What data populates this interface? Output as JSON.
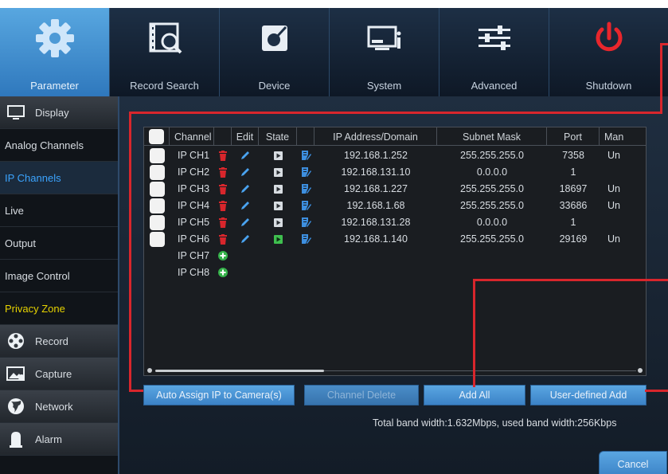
{
  "toolbar": {
    "items": [
      {
        "label": "Parameter",
        "icon": "gear-icon",
        "active": true
      },
      {
        "label": "Record Search",
        "icon": "film-search-icon"
      },
      {
        "label": "Device",
        "icon": "device-icon"
      },
      {
        "label": "System",
        "icon": "system-icon"
      },
      {
        "label": "Advanced",
        "icon": "sliders-icon"
      },
      {
        "label": "Shutdown",
        "icon": "power-icon"
      }
    ]
  },
  "sidebar": {
    "items": [
      {
        "label": "Display",
        "type": "category",
        "icon": "monitor-icon"
      },
      {
        "label": "Analog Channels",
        "type": "sub"
      },
      {
        "label": "IP Channels",
        "type": "sub",
        "selected": true
      },
      {
        "label": "Live",
        "type": "sub"
      },
      {
        "label": "Output",
        "type": "sub"
      },
      {
        "label": "Image Control",
        "type": "sub"
      },
      {
        "label": "Privacy Zone",
        "type": "sub",
        "highlight": true
      },
      {
        "label": "Record",
        "type": "category",
        "icon": "film-reel-icon"
      },
      {
        "label": "Capture",
        "type": "category",
        "icon": "capture-icon"
      },
      {
        "label": "Network",
        "type": "category",
        "icon": "globe-icon"
      },
      {
        "label": "Alarm",
        "type": "category",
        "icon": "alarm-icon"
      }
    ]
  },
  "table": {
    "headers": {
      "channel": "Channel",
      "edit": "Edit",
      "state": "State",
      "ip": "IP Address/Domain",
      "mask": "Subnet Mask",
      "port": "Port",
      "manufacturer": "Man"
    },
    "rows": [
      {
        "channel": "IP CH1",
        "ip": "192.168.1.252",
        "mask": "255.255.255.0",
        "port": "7358",
        "man": "Un",
        "configured": true,
        "state": "idle"
      },
      {
        "channel": "IP CH2",
        "ip": "192.168.131.10",
        "mask": "0.0.0.0",
        "port": "1",
        "man": "",
        "configured": true,
        "state": "idle"
      },
      {
        "channel": "IP CH3",
        "ip": "192.168.1.227",
        "mask": "255.255.255.0",
        "port": "18697",
        "man": "Un",
        "configured": true,
        "state": "idle"
      },
      {
        "channel": "IP CH4",
        "ip": "192.168.1.68",
        "mask": "255.255.255.0",
        "port": "33686",
        "man": "Un",
        "configured": true,
        "state": "idle"
      },
      {
        "channel": "IP CH5",
        "ip": "192.168.131.28",
        "mask": "0.0.0.0",
        "port": "1",
        "man": "",
        "configured": true,
        "state": "idle"
      },
      {
        "channel": "IP CH6",
        "ip": "192.168.1.140",
        "mask": "255.255.255.0",
        "port": "29169",
        "man": "Un",
        "configured": true,
        "state": "connected"
      },
      {
        "channel": "IP CH7",
        "configured": false
      },
      {
        "channel": "IP CH8",
        "configured": false
      }
    ]
  },
  "buttons": {
    "auto_assign": "Auto Assign IP to Camera(s)",
    "channel_delete": "Channel Delete",
    "add_all": "Add All",
    "user_defined_add": "User-defined Add",
    "cancel": "Cancel"
  },
  "status": {
    "bandwidth": "Total band width:1.632Mbps, used band width:256Kbps"
  },
  "colors": {
    "accent": "#3ba4ff",
    "highlight": "#e6d200",
    "delete": "#d8262c",
    "add": "#35b24a",
    "annotation": "#d8262c"
  }
}
